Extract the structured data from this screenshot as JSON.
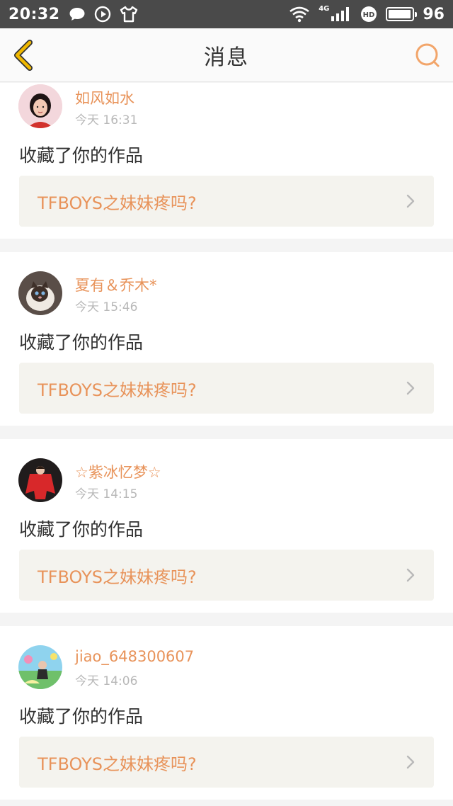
{
  "status_bar": {
    "time": "20:32",
    "network": "4G",
    "battery": "96",
    "battery_level": 0.96,
    "left_icons": [
      "message-icon",
      "play-icon",
      "tshirt-icon"
    ],
    "right_icons": [
      "wifi-icon",
      "signal-icon",
      "hd-icon",
      "battery-icon"
    ]
  },
  "header": {
    "title": "消息",
    "back_icon": "chevron-left-icon",
    "search_icon": "search-icon"
  },
  "colors": {
    "accent": "#e8935a",
    "back_arrow": "#f0b800",
    "background": "#f4f4f4",
    "work_box": "#f4f3ee"
  },
  "messages": [
    {
      "username": "如风如水",
      "time": "今天 16:31",
      "action": "收藏了你的作品",
      "work_title": "TFBOYS之妹妹疼吗?"
    },
    {
      "username": "夏有＆乔木*",
      "time": "今天 15:46",
      "action": "收藏了你的作品",
      "work_title": "TFBOYS之妹妹疼吗?"
    },
    {
      "username": "☆紫冰忆梦☆",
      "time": "今天 14:15",
      "action": "收藏了你的作品",
      "work_title": "TFBOYS之妹妹疼吗?"
    },
    {
      "username": "jiao_648300607",
      "time": "今天 14:06",
      "action": "收藏了你的作品",
      "work_title": "TFBOYS之妹妹疼吗?"
    }
  ]
}
